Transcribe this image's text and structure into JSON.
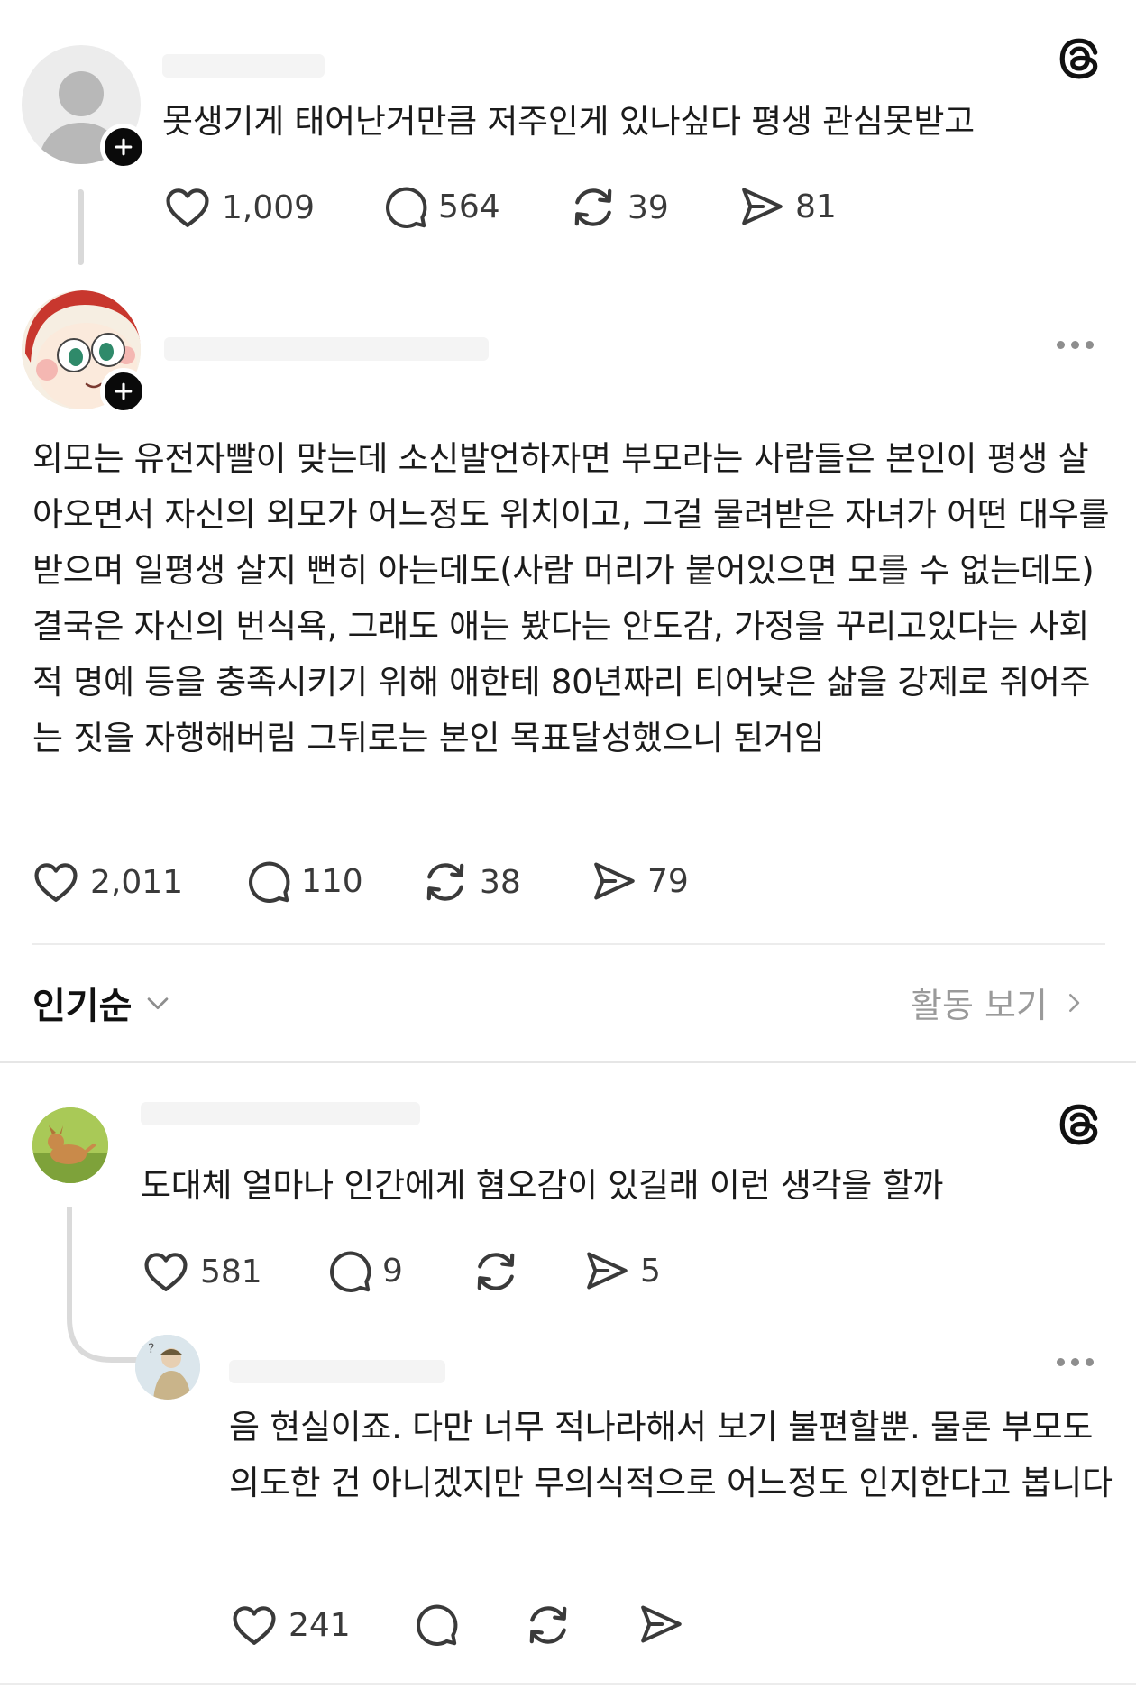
{
  "posts": [
    {
      "text": "못생기게 태어난거만큼 저주인게 있나싶다 평생 관심못받고",
      "likes": "1,009",
      "replies": "564",
      "reposts": "39",
      "shares": "81"
    },
    {
      "text": "외모는 유전자빨이 맞는데 소신발언하자면 부모라는 사람들은 본인이 평생 살아오면서 자신의 외모가 어느정도 위치이고, 그걸 물려받은 자녀가 어떤 대우를 받으며 일평생 살지 뻔히 아는데도(사람 머리가 붙어있으면 모를 수 없는데도) 결국은 자신의 번식욕, 그래도 애는 봤다는 안도감, 가정을 꾸리고있다는 사회적 명예 등을 충족시키기 위해 애한테 80년짜리 티어낮은 삶을 강제로 쥐어주는 짓을 자행해버림 그뒤로는 본인 목표달성했으니 된거임",
      "likes": "2,011",
      "replies": "110",
      "reposts": "38",
      "shares": "79"
    }
  ],
  "sort_bar": {
    "sort_label": "인기순",
    "activity_label": "활동 보기"
  },
  "comments": [
    {
      "text": "도대체 얼마나 인간에게 혐오감이 있길래 이런 생각을 할까",
      "likes": "581",
      "replies": "9",
      "reposts": "",
      "shares": "5"
    },
    {
      "text": "음 현실이죠. 다만 너무 적나라해서 보기 불편할뿐. 물론 부모도 의도한 건 아니겠지만 무의식적으로 어느정도 인지한다고 봅니다",
      "likes": "241",
      "replies": "",
      "reposts": "",
      "shares": ""
    }
  ],
  "icons": {
    "threads_logo": "threads-logo-icon",
    "like": "heart-icon",
    "reply": "speech-bubble-icon",
    "repost": "repost-arrows-icon",
    "share": "send-icon",
    "more": "more-dots-icon",
    "follow": "plus-icon",
    "sort": "chevron-down-icon",
    "activity": "chevron-right-icon"
  },
  "colors": {
    "text": "#1b1b1b",
    "muted": "#8e8e8e",
    "badge": "#0a0a0a"
  }
}
